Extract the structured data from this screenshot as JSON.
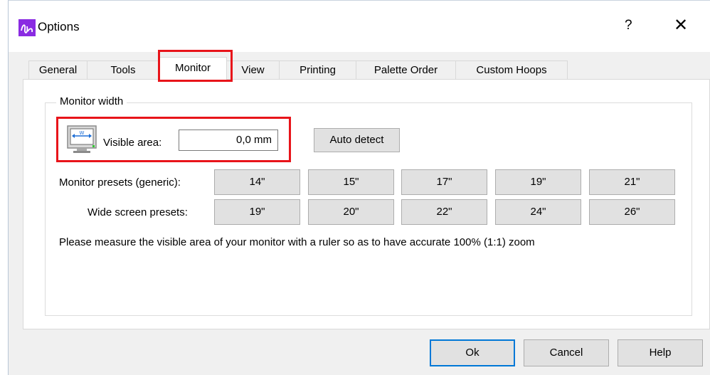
{
  "window": {
    "title": "Options",
    "help_symbol": "?",
    "close_symbol": "✕",
    "icon": "app-logo-icon",
    "icon_color": "#8a2be2"
  },
  "tabs": [
    {
      "label": "General"
    },
    {
      "label": "Tools"
    },
    {
      "label": "Monitor"
    },
    {
      "label": "View"
    },
    {
      "label": "Printing"
    },
    {
      "label": "Palette Order"
    },
    {
      "label": "Custom Hoops"
    }
  ],
  "active_tab": "Monitor",
  "highlight_color": "#e8141a",
  "monitor": {
    "group_title": "Monitor width",
    "icon": "monitor-width-icon",
    "visible_area_label": "Visible area:",
    "visible_area_value": "0,0 mm",
    "auto_detect_label": "Auto detect",
    "generic_label": "Monitor presets (generic):",
    "generic_presets": [
      "14\"",
      "15\"",
      "17\"",
      "19\"",
      "21\""
    ],
    "wide_label": "Wide screen presets:",
    "wide_presets": [
      "19\"",
      "20\"",
      "22\"",
      "24\"",
      "26\""
    ],
    "note": "Please measure the visible area of your monitor with a ruler so as to have accurate 100% (1:1) zoom"
  },
  "footer": {
    "ok_label": "Ok",
    "cancel_label": "Cancel",
    "help_label": "Help"
  }
}
